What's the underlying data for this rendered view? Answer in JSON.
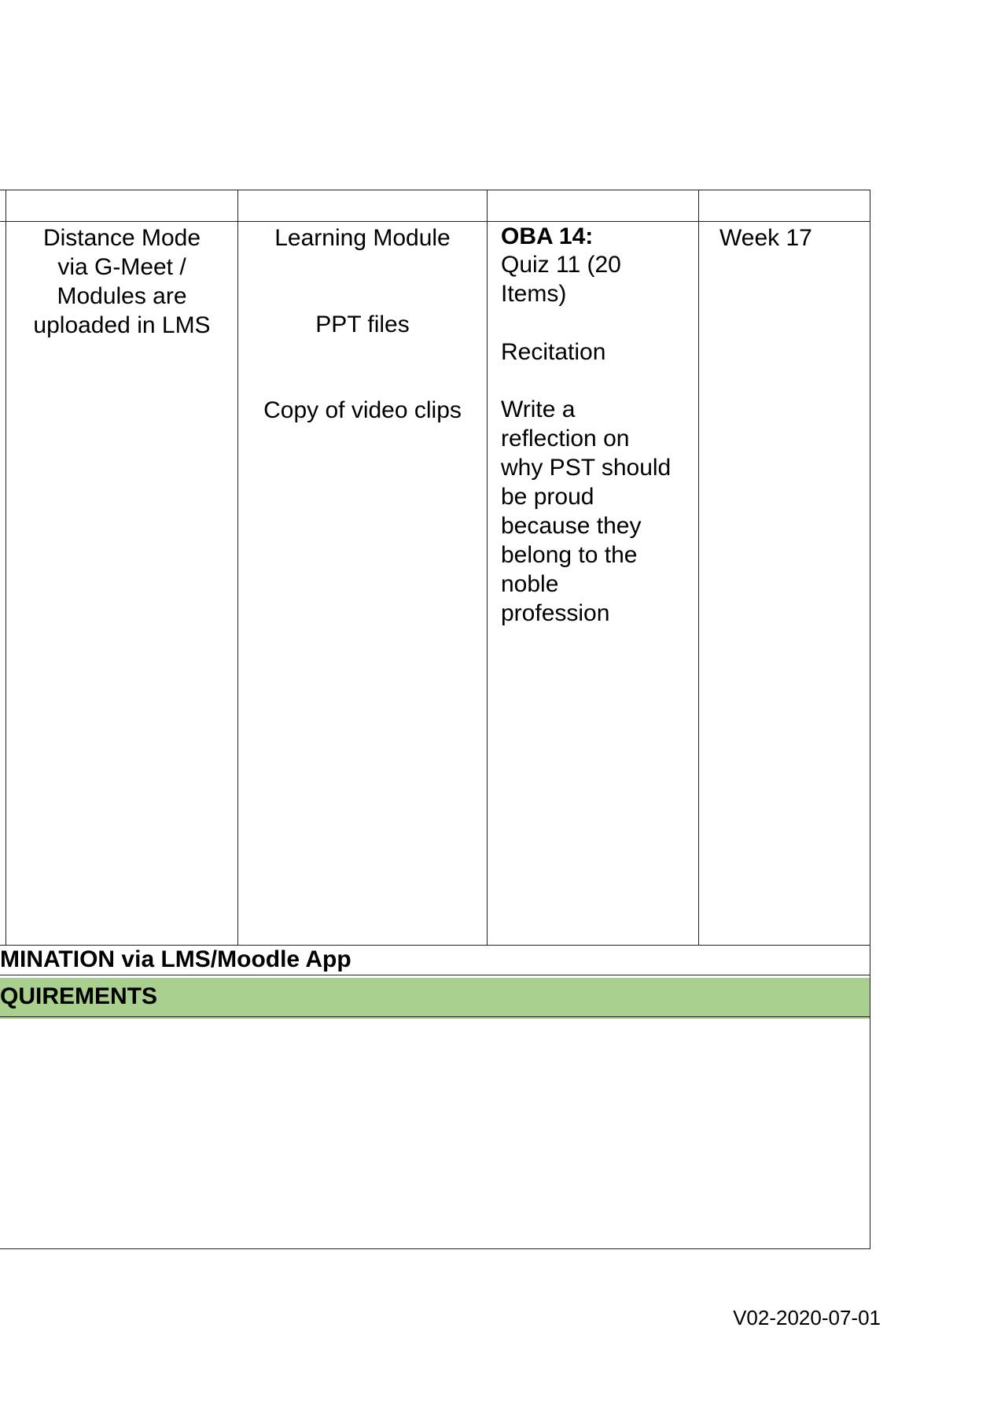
{
  "table": {
    "row": {
      "delivery_mode": "Distance Mode\nvia G-Meet /\nModules are\nuploaded in LMS",
      "resources": {
        "item1": "Learning Module",
        "item2": "PPT files",
        "item3": "Copy of video clips"
      },
      "assessment": {
        "heading": "OBA 14:",
        "quiz": "Quiz 11 (20\nItems)",
        "recitation": "Recitation",
        "reflection": "Write a\nreflection on\nwhy PST should\nbe proud\nbecause they\nbelong to the\nnoble\nprofession"
      },
      "schedule": "Week 17"
    },
    "exam_row": "MINATION via LMS/Moodle App",
    "requirements_row": "QUIREMENTS",
    "band_color": "#a9d08e"
  },
  "footer": {
    "version": "V02-2020-07-01"
  }
}
